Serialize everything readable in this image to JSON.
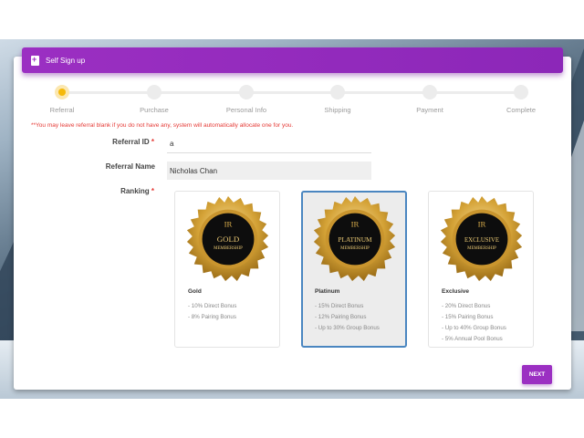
{
  "header": {
    "title": "Self Sign up",
    "icon": "add-document-icon",
    "color": "#9b2fc2"
  },
  "stepper": {
    "steps": [
      {
        "label": "Referral",
        "active": true
      },
      {
        "label": "Purchase",
        "active": false
      },
      {
        "label": "Personal Info",
        "active": false
      },
      {
        "label": "Shipping",
        "active": false
      },
      {
        "label": "Payment",
        "active": false
      },
      {
        "label": "Complete",
        "active": false
      }
    ]
  },
  "notice": "**You may leave referral blank if you do not have any, system will automatically allocate one for you.",
  "form": {
    "referral_id": {
      "label": "Referral ID",
      "required": "*",
      "value": "a"
    },
    "referral_name": {
      "label": "Referral Name",
      "value": "Nicholas Chan"
    },
    "ranking": {
      "label": "Ranking",
      "required": "*"
    }
  },
  "rankings": [
    {
      "name": "Gold",
      "badge_top": "GOLD",
      "badge_bottom": "MEMBERSHIP",
      "badge_logo": "IR",
      "selected": false,
      "benefits": [
        "- 10% Direct Bonus",
        "- 8% Pairing Bonus"
      ]
    },
    {
      "name": "Platinum",
      "badge_top": "PLATINUM",
      "badge_bottom": "MEMBERSHIP",
      "badge_logo": "IR",
      "selected": true,
      "benefits": [
        "- 15% Direct Bonus",
        "- 12% Pairing Bonus",
        "- Up to 30% Group Bonus"
      ]
    },
    {
      "name": "Exclusive",
      "badge_top": "EXCLUSIVE",
      "badge_bottom": "MEMBERSHIP",
      "badge_logo": "IR",
      "selected": false,
      "benefits": [
        "- 20% Direct Bonus",
        "- 15% Pairing Bonus",
        "- Up to 40% Group Bonus",
        "- 5% Annual Pool Bonus"
      ]
    }
  ],
  "next_label": "NEXT",
  "colors": {
    "accent": "#9b2fc2",
    "active_step": "#f5b90a",
    "required": "#e53935",
    "selected_border": "#4a86c0"
  }
}
